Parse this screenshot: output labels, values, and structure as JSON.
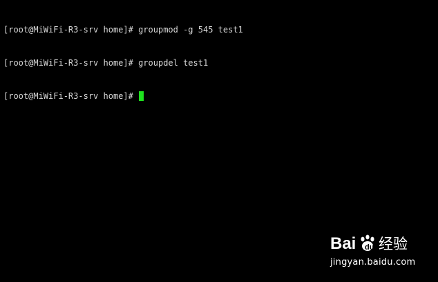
{
  "terminal": {
    "lines": [
      "[root@MiWiFi-R3-srv home]# groupmod -g 545 test1",
      "[root@MiWiFi-R3-srv home]# groupdel test1",
      "[root@MiWiFi-R3-srv home]# "
    ],
    "cursor_color": "#1ee21e",
    "text_color": "#d8d8d8",
    "background": "#000000"
  },
  "watermark": {
    "logo_text": "Bai du 经验",
    "url": "jingyan.baidu.com"
  }
}
